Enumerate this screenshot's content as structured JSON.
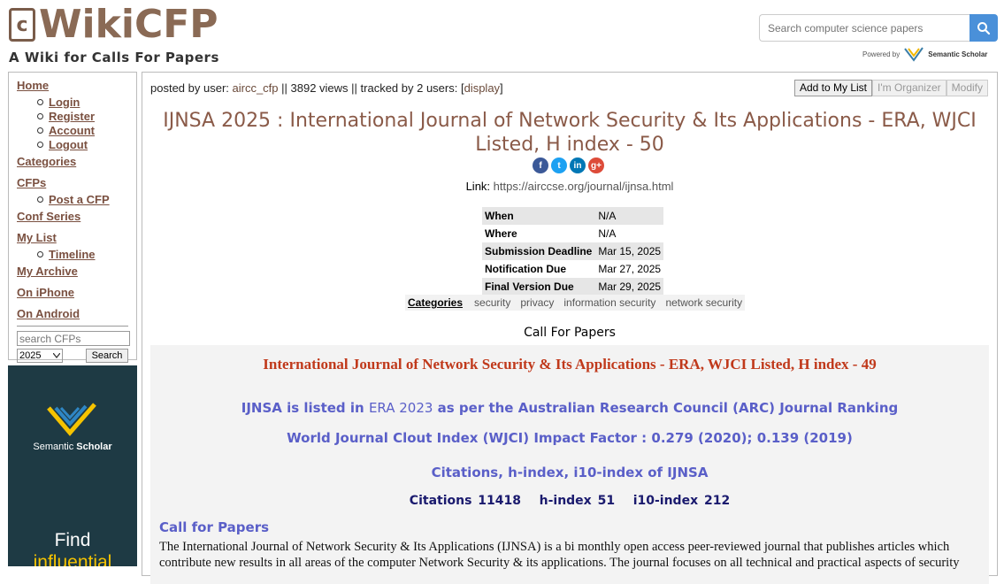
{
  "header": {
    "logo_letter": "c",
    "logo_text": "WikiCFP",
    "tagline": "A Wiki for Calls For Papers",
    "search_placeholder": "Search computer science papers",
    "powered_by": "Powered by",
    "powered_brand": "Semantic Scholar"
  },
  "sidebar": {
    "home": "Home",
    "home_sub": [
      "Login",
      "Register",
      "Account",
      "Logout"
    ],
    "categories": "Categories",
    "cfps": "CFPs",
    "cfps_sub": [
      "Post a CFP"
    ],
    "conf_series": "Conf Series",
    "my_list": "My List",
    "my_list_sub": [
      "Timeline"
    ],
    "my_archive": "My Archive",
    "on_iphone": "On iPhone",
    "on_android": "On Android",
    "search_placeholder": "search CFPs",
    "year": "2025",
    "search_button": "Search"
  },
  "ad": {
    "brand_prefix": "Semantic ",
    "brand_bold": "Scholar",
    "line1": "Find",
    "line2": "influential"
  },
  "main": {
    "posted_prefix": "posted by user: ",
    "posted_user": "aircc_cfp",
    "posted_mid": " || 3892 views || tracked by 2 users: [",
    "display_link": "display",
    "posted_end": "]",
    "actions": [
      "Add to My List",
      "I'm Organizer",
      "Modify"
    ],
    "title_line1": "IJNSA 2025 : International Journal of Network Security & Its Applications - ERA, WJCI",
    "title_line2": "Listed, H index - 50",
    "social_icons": [
      "facebook-icon",
      "twitter-icon",
      "linkedin-icon",
      "googleplus-icon"
    ],
    "link_label": "Link: ",
    "link_url": "https://airccse.org/journal/ijnsa.html",
    "info": [
      {
        "k": "When",
        "v": "N/A"
      },
      {
        "k": "Where",
        "v": "N/A"
      },
      {
        "k": "Submission Deadline",
        "v": "Mar 15, 2025"
      },
      {
        "k": "Notification Due",
        "v": "Mar 27, 2025"
      },
      {
        "k": "Final Version Due",
        "v": "Mar 29, 2025"
      }
    ],
    "categories_label": "Categories",
    "categories": [
      "security",
      "privacy",
      "information security",
      "network security"
    ],
    "cfp_heading": "Call For Papers"
  },
  "content": {
    "title": "International Journal of Network Security & Its Applications - ERA, WJCI Listed, H index - 49",
    "era_prefix": "IJNSA is listed in ",
    "era_link": "ERA 2023",
    "era_suffix": " as per the Australian Research Council (ARC) Journal Ranking",
    "wjci": "World Journal Clout Index (WJCI) Impact Factor : 0.279 (2020); 0.139 (2019)",
    "citations_link": "Citations, h-index, i10-index of IJNSA",
    "citations": "Citations 11418   h-index 51   i10-index 212",
    "cfp": "Call for Papers",
    "paragraph": "The International Journal of Network Security & Its Applications (IJNSA) is a bi monthly open access peer-reviewed journal that publishes articles which contribute new results in all areas of the computer Network Security & its applications. The journal focuses on all technical and practical aspects of security"
  },
  "colors": {
    "logo": "#8a6a55",
    "title": "#8a5a48",
    "content_title": "#c0391b",
    "content_blue": "#5a5fc8",
    "search_button": "#4a90d9",
    "ad_bg": "#1e3a44",
    "ad_accent": "#f5c300"
  }
}
